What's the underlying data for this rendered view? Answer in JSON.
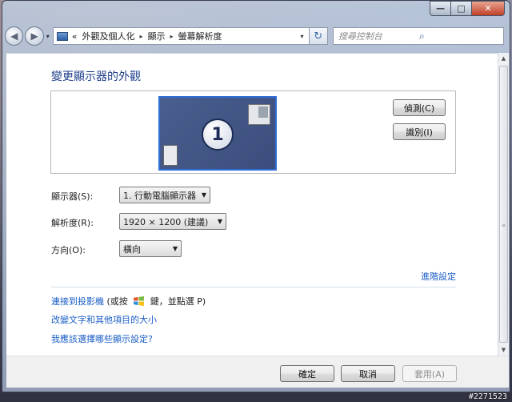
{
  "window": {
    "caption_buttons": {
      "minimize": "—",
      "maximize": "□",
      "close": "✕"
    }
  },
  "nav": {
    "back_glyph": "◀",
    "forward_glyph": "▶",
    "history_dropdown": "▾",
    "breadcrumb_prefix": "«",
    "breadcrumbs": [
      "外觀及個人化",
      "顯示",
      "螢幕解析度"
    ],
    "breadcrumb_separator": "▸",
    "refresh_glyph": "↻",
    "search_placeholder": "搜尋控制台",
    "search_glyph": "⌕"
  },
  "main": {
    "title": "變更顯示器的外觀",
    "preview": {
      "monitor_number": "1",
      "detect_button": "偵測(C)",
      "identify_button": "識別(I)"
    },
    "fields": [
      {
        "label": "顯示器(S):",
        "value": "1. 行動電腦顯示器"
      },
      {
        "label": "解析度(R):",
        "value": "1920 × 1200 (建議)"
      },
      {
        "label": "方向(O):",
        "value": "橫向"
      }
    ],
    "advanced_link": "進階設定",
    "links": {
      "projector_text": "連接到投影機",
      "projector_hint_pre": "(或按",
      "projector_hint_post": "鍵，並點選 P)",
      "text_size": "改變文字和其他項目的大小",
      "which_settings": "我應該選擇哪些顯示設定?"
    }
  },
  "footer": {
    "ok": "確定",
    "cancel": "取消",
    "apply": "套用(A)"
  },
  "watermark": "#2271523",
  "icons": [
    "control-panel-icon",
    "windows-logo-icon",
    "search-icon",
    "refresh-icon"
  ],
  "colors": {
    "link": "#1a5dc5",
    "title": "#1e3f8a",
    "monitor_border": "#2f6fd6"
  }
}
